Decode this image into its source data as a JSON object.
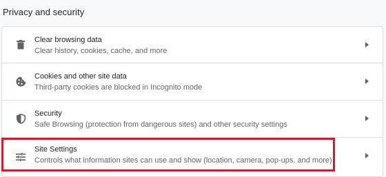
{
  "section": {
    "title": "Privacy and security"
  },
  "rows": [
    {
      "icon": "trash-icon",
      "title": "Clear browsing data",
      "subtitle": "Clear history, cookies, cache, and more"
    },
    {
      "icon": "cookie-icon",
      "title": "Cookies and other site data",
      "subtitle": "Third-party cookies are blocked in Incognito mode"
    },
    {
      "icon": "shield-icon",
      "title": "Security",
      "subtitle": "Safe Browsing (protection from dangerous sites) and other security settings"
    },
    {
      "icon": "tune-sliders-icon",
      "title": "Site Settings",
      "subtitle": "Controls what information sites can use and show (location, camera, pop-ups, and more)"
    }
  ],
  "chevron_icon": "chevron-right-icon",
  "colors": {
    "page_background": "#f8f9fa",
    "card_background": "#ffffff",
    "text_primary": "#202124",
    "text_secondary": "#5f6368",
    "icon": "#5f6368",
    "highlight_border": "#d7192b"
  }
}
